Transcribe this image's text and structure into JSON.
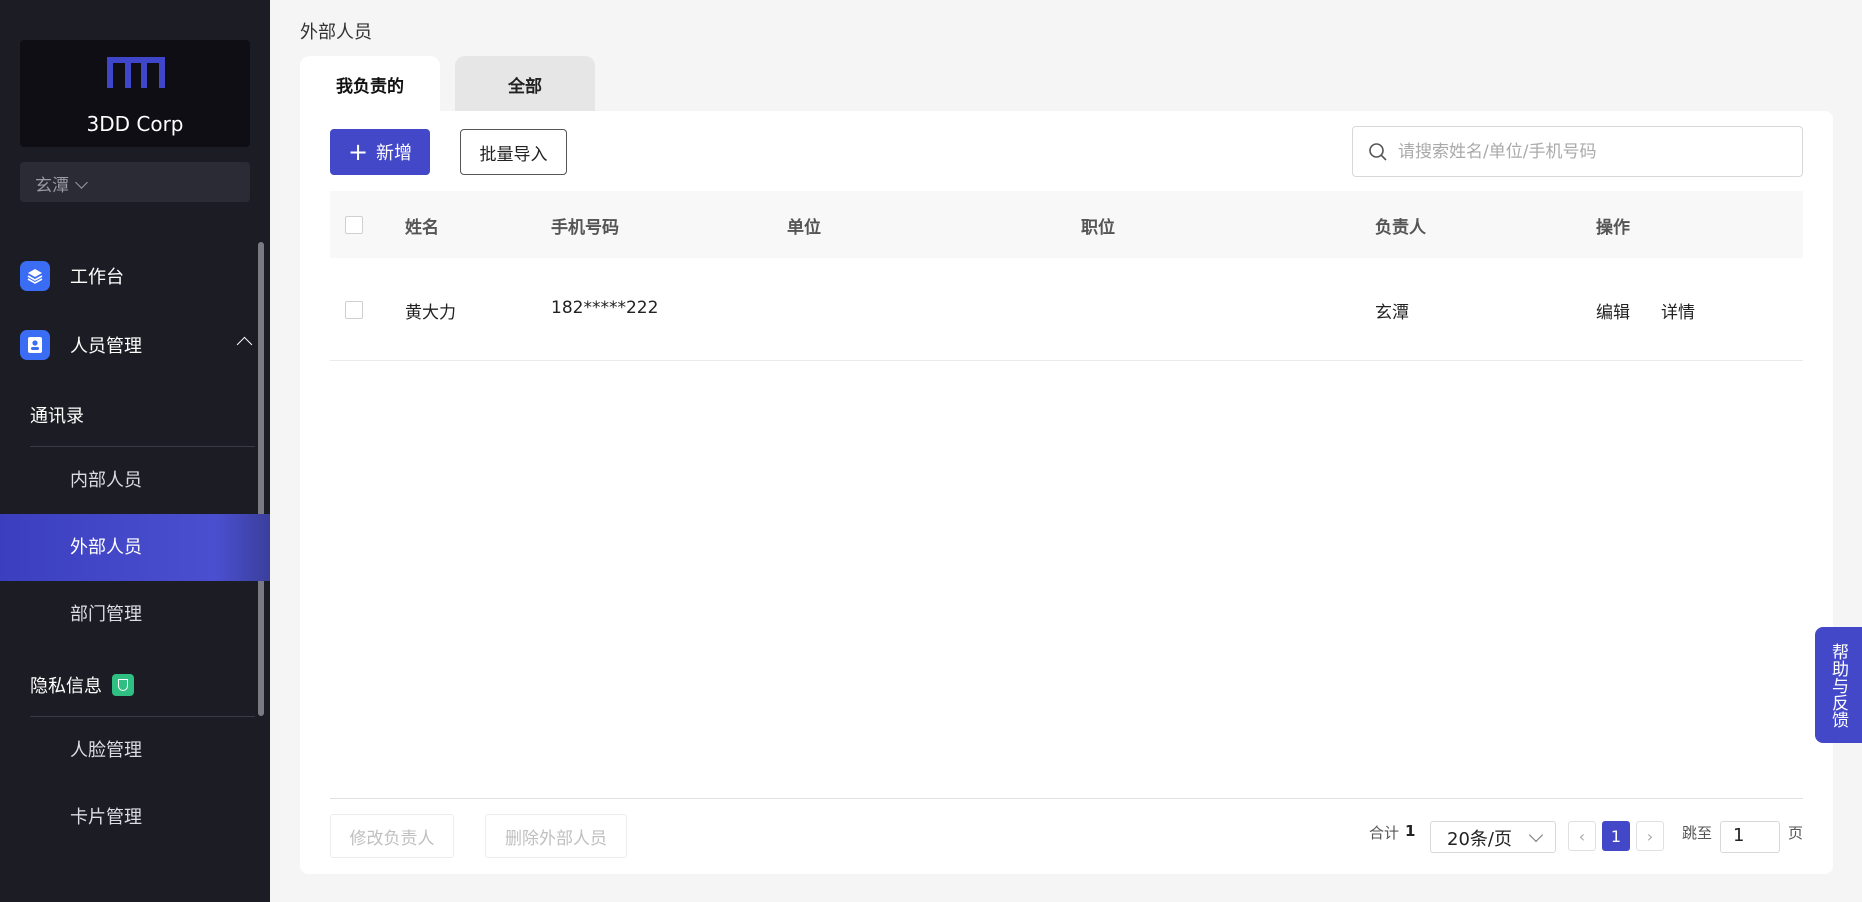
{
  "brand": {
    "name": "3DD Corp"
  },
  "org_selector": {
    "value": "玄潭"
  },
  "sidebar": {
    "workbench": "工作台",
    "people": "人员管理",
    "contacts_group": "通讯录",
    "internal": "内部人员",
    "external": "外部人员",
    "departments": "部门管理",
    "privacy_group": "隐私信息",
    "face": "人脸管理",
    "card": "卡片管理"
  },
  "breadcrumb": "外部人员",
  "tabs": [
    {
      "label": "我负责的",
      "active": true
    },
    {
      "label": "全部",
      "active": false
    }
  ],
  "toolbar": {
    "add_label": "新增",
    "import_label": "批量导入",
    "search_placeholder": "请搜索姓名/单位/手机号码"
  },
  "table": {
    "columns": [
      "姓名",
      "手机号码",
      "单位",
      "职位",
      "负责人",
      "操作"
    ],
    "rows": [
      {
        "name": "黄大力",
        "phone": "182*****222",
        "company": "",
        "position": "",
        "owner": "玄潭",
        "actions": [
          "编辑",
          "详情"
        ]
      }
    ]
  },
  "footer": {
    "change_owner": "修改负责人",
    "delete_external": "删除外部人员",
    "total_label": "合计",
    "total": "1",
    "page_size": "20条/页",
    "current_page": "1",
    "jump_label": "跳至",
    "jump_value": "1",
    "page_unit": "页"
  },
  "help_label": "帮助与反馈",
  "colors": {
    "accent": "#4348c8",
    "sidebar_bg": "#1c1c24",
    "link": "#3b50c4",
    "privacy_badge": "#2fbf82"
  }
}
